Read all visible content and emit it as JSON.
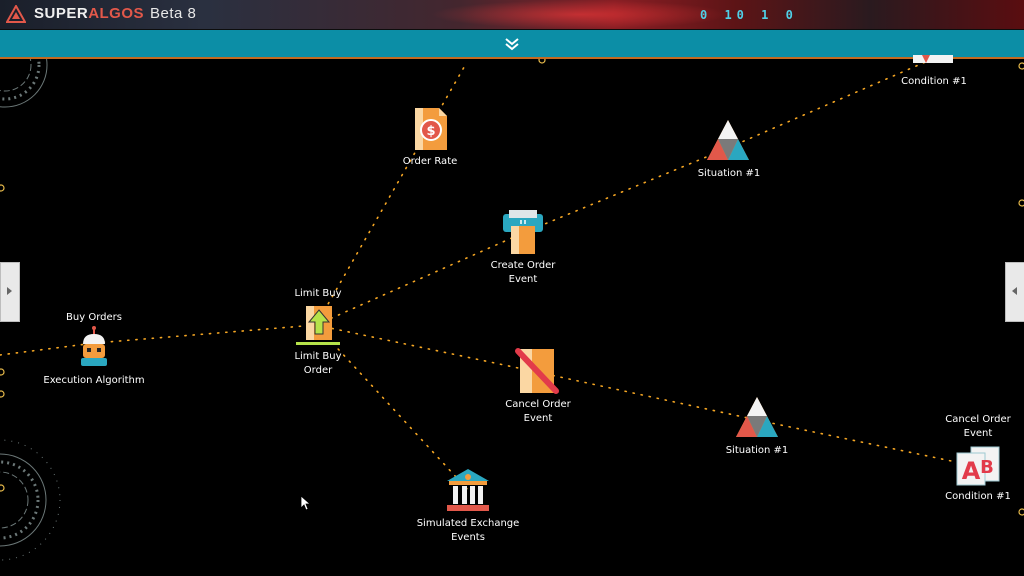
{
  "app": {
    "brand_super": "SUPER",
    "brand_algos": "ALGOS",
    "version": "Beta 8",
    "binary_readout": "0 10 1 0"
  },
  "colors": {
    "cyan_bar": "#0c8ea6",
    "link_dots": "#f5a623",
    "accent_orange": "#f39c3d",
    "accent_red": "#e2584a",
    "background": "#000000"
  },
  "nodes": {
    "condition_top": {
      "label": "Condition #1",
      "icon": "condition-icon"
    },
    "order_rate": {
      "label": "Order Rate",
      "icon": "order-rate-icon"
    },
    "situation_top": {
      "label": "Situation #1",
      "icon": "situation-icon"
    },
    "create_order_event": {
      "label_line1": "Create Order",
      "label_line2": "Event",
      "icon": "create-order-event-icon"
    },
    "buy_orders_execution": {
      "parent_label": "Buy Orders",
      "label": "Execution Algorithm",
      "icon": "execution-algorithm-icon"
    },
    "limit_buy_order": {
      "parent_label": "Limit Buy",
      "label_line1": "Limit Buy",
      "label_line2": "Order",
      "icon": "limit-buy-order-icon"
    },
    "cancel_order_event": {
      "label_line1": "Cancel Order",
      "label_line2": "Event",
      "icon": "cancel-order-event-icon"
    },
    "situation_bottom": {
      "label": "Situation #1",
      "icon": "situation-icon"
    },
    "condition_bottom": {
      "parent_line1": "Cancel Order",
      "parent_line2": "Event",
      "label": "Condition #1",
      "icon": "condition-icon"
    },
    "simulated_exchange_events": {
      "label_line1": "Simulated Exchange",
      "label_line2": "Events",
      "icon": "simulated-exchange-events-icon"
    }
  },
  "controls": {
    "collapse_icon": "double-chevron-down-icon",
    "left_panel_icon": "caret-left-icon",
    "right_panel_icon": "caret-right-icon"
  }
}
